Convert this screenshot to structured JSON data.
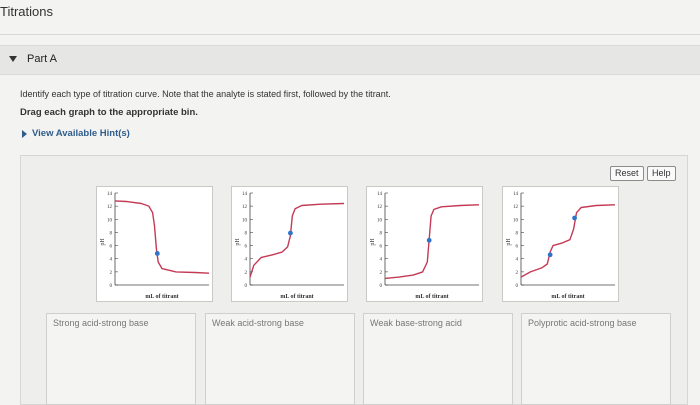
{
  "page": {
    "title": "Titrations",
    "part_label": "Part A",
    "instruction": "Identify each type of titration curve. Note that the analyte is stated first, followed by the titrant.",
    "drag_instruction": "Drag each graph to the appropriate bin.",
    "hints_link": "View Available Hint(s)"
  },
  "toolbar": {
    "reset_label": "Reset",
    "help_label": "Help"
  },
  "graph": {
    "y_ticks": [
      "14",
      "12",
      "10",
      "8",
      "6",
      "4",
      "2",
      "0"
    ],
    "y_label": "pH",
    "x_label": "mL of titrant"
  },
  "graphs": [
    {
      "curve": "strong-base-titrated-by-strong-acid"
    },
    {
      "curve": "weak-acid-titrated-by-strong-base"
    },
    {
      "curve": "strong-acid-titrated-by-strong-base"
    },
    {
      "curve": "polyprotic-acid-titrated-by-strong-base"
    }
  ],
  "bins": [
    {
      "label": "Strong acid-strong base"
    },
    {
      "label": "Weak acid-strong base"
    },
    {
      "label": "Weak base-strong acid"
    },
    {
      "label": "Polyprotic acid-strong base"
    }
  ],
  "colors": {
    "curve": "#c43a55",
    "point": "#2f74c9",
    "link": "#2f5d8c"
  }
}
